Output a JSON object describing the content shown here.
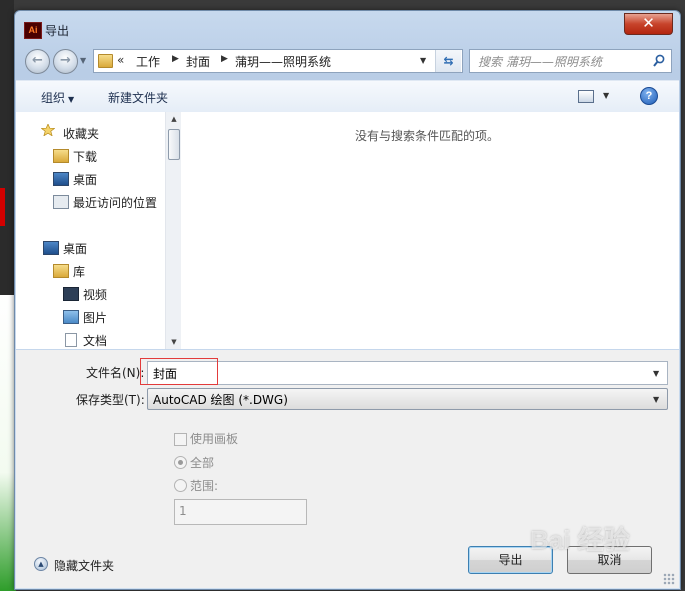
{
  "window": {
    "app_icon": "Ai",
    "title": "导出",
    "close_label": "✕"
  },
  "nav": {
    "address_prefix": "«",
    "breadcrumbs": [
      "工作",
      "封面",
      "蒲玥——照明系统"
    ],
    "search_placeholder": "搜索 蒲玥——照明系统"
  },
  "toolbar": {
    "organize": "组织",
    "new_folder": "新建文件夹",
    "help": "?"
  },
  "sidebar": {
    "favorites_header": "收藏夹",
    "favorites": [
      "下载",
      "桌面",
      "最近访问的位置"
    ],
    "desktop_header": "桌面",
    "library": "库",
    "library_items": [
      "视频",
      "图片",
      "文档"
    ]
  },
  "file_list": {
    "empty_message": "没有与搜索条件匹配的项。"
  },
  "form": {
    "filename_label": "文件名(N):",
    "filename_value": "封面",
    "filetype_label": "保存类型(T):",
    "filetype_value": "AutoCAD 绘图 (*.DWG)",
    "use_artboards": "使用画板",
    "all_label": "全部",
    "range_label": "范围:",
    "range_value": "1"
  },
  "footer": {
    "hide_folders": "隐藏文件夹",
    "export_button": "导出",
    "cancel_button": "取消"
  },
  "watermark": "Bai 经验",
  "colors": {
    "highlight_border": "#e23b3b",
    "title_bar": "#c7d9ee",
    "close_button": "#c7432b"
  }
}
